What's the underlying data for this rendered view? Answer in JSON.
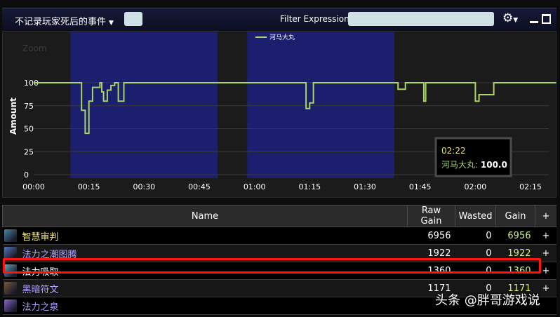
{
  "topbar": {
    "filter_dropdown": "不记录玩家死后的事件",
    "filter_expression_label": "Filter Expression:",
    "filter_expression_value": ""
  },
  "chart_data": {
    "type": "line",
    "title": "",
    "zoom_label": "Zoom",
    "ylabel": "Amount",
    "xlabel": "",
    "ylim": [
      0,
      100
    ],
    "yticks": [
      "0",
      "25",
      "50",
      "75",
      "100"
    ],
    "xticks": [
      "00:00",
      "00:15",
      "00:30",
      "00:45",
      "01:00",
      "01:15",
      "01:30",
      "01:45",
      "02:00",
      "02:15"
    ],
    "legend_position": "top-center",
    "series": [
      {
        "name": "河马大丸",
        "color": "#a8d46a",
        "points": [
          [
            "00:00",
            100
          ],
          [
            "00:13",
            100
          ],
          [
            "00:13",
            70
          ],
          [
            "00:14",
            70
          ],
          [
            "00:14",
            45
          ],
          [
            "00:15",
            45
          ],
          [
            "00:15",
            80
          ],
          [
            "00:16",
            80
          ],
          [
            "00:16",
            95
          ],
          [
            "00:18",
            95
          ],
          [
            "00:18",
            100
          ],
          [
            "00:18.5",
            100
          ],
          [
            "00:18.5",
            90
          ],
          [
            "00:19",
            90
          ],
          [
            "00:19",
            80
          ],
          [
            "00:20",
            80
          ],
          [
            "00:20",
            92
          ],
          [
            "00:21",
            92
          ],
          [
            "00:21",
            97
          ],
          [
            "00:22",
            97
          ],
          [
            "00:22",
            100
          ],
          [
            "00:23",
            100
          ],
          [
            "00:23",
            80
          ],
          [
            "00:24.5",
            80
          ],
          [
            "00:24.5",
            100
          ],
          [
            "01:14",
            100
          ],
          [
            "01:14",
            72
          ],
          [
            "01:15",
            72
          ],
          [
            "01:15",
            78
          ],
          [
            "01:16",
            78
          ],
          [
            "01:16",
            100
          ],
          [
            "01:39",
            100
          ],
          [
            "01:39",
            93
          ],
          [
            "01:41",
            93
          ],
          [
            "01:41",
            100
          ],
          [
            "01:46",
            100
          ],
          [
            "01:46",
            80
          ],
          [
            "01:46.5",
            80
          ],
          [
            "01:46.5",
            100
          ],
          [
            "02:00",
            100
          ],
          [
            "02:00",
            80
          ],
          [
            "02:01",
            80
          ],
          [
            "02:01",
            87
          ],
          [
            "02:05",
            87
          ],
          [
            "02:05",
            100
          ],
          [
            "02:22",
            100
          ]
        ]
      }
    ],
    "shaded_regions": [
      [
        "00:10",
        "00:50"
      ],
      [
        "00:58",
        "01:38"
      ]
    ],
    "tooltip": {
      "time": "02:22",
      "series": "河马大丸",
      "value": "100.0"
    }
  },
  "table": {
    "headers": [
      "Name",
      "Raw Gain",
      "Wasted",
      "Gain",
      "+"
    ],
    "rows": [
      {
        "name": "智慧审判",
        "name_color": "#f3e684",
        "icon": "judgement-of-wisdom-icon",
        "icon_color": "#4b87a6",
        "raw": "6956",
        "wasted": "0",
        "gain": "6956",
        "plus": "+"
      },
      {
        "name": "法力之潮图腾",
        "name_color": "#b3a4ff",
        "icon": "mana-tide-totem-icon",
        "icon_color": "#5577b8",
        "raw": "1922",
        "wasted": "0",
        "gain": "1922",
        "plus": "+"
      },
      {
        "name": "法力吸取",
        "name_color": "#ffffff",
        "icon": "mana-drain-icon",
        "icon_color": "#66aabb",
        "raw": "1360",
        "wasted": "0",
        "gain": "1360",
        "plus": "+"
      },
      {
        "name": "黑暗符文",
        "name_color": "#b3a4ff",
        "icon": "dark-rune-icon",
        "icon_color": "#7a5a3a",
        "raw": "1171",
        "wasted": "0",
        "gain": "1171",
        "plus": "+"
      },
      {
        "name": "法力之泉",
        "name_color": "#b3a4ff",
        "icon": "mana-spring-icon",
        "icon_color": "#8a64c8",
        "raw": "",
        "wasted": "",
        "gain": "",
        "plus": ""
      }
    ]
  },
  "watermark": "头条 @胖哥游戏说"
}
